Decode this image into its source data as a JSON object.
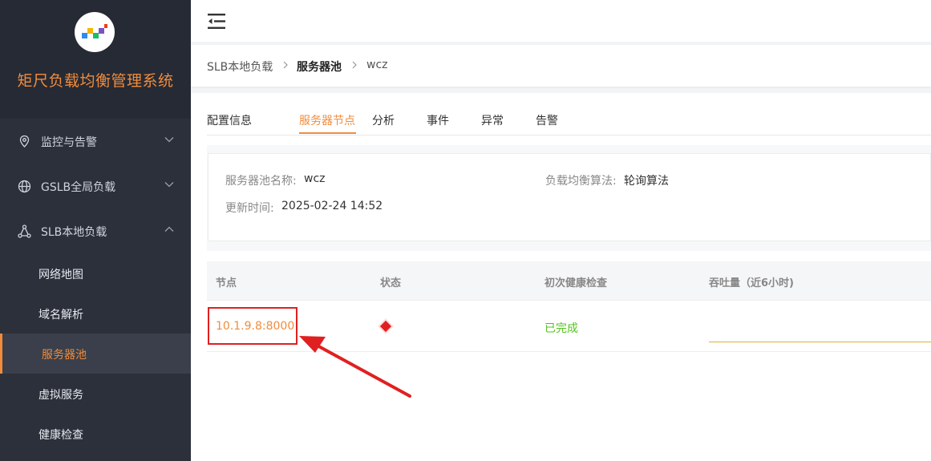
{
  "app": {
    "title": "矩尺负载均衡管理系统"
  },
  "sidebar": {
    "groups": [
      {
        "label": "监控与告警",
        "icon": "location-pin-icon"
      },
      {
        "label": "GSLB全局负载",
        "icon": "globe-icon"
      },
      {
        "label": "SLB本地负载",
        "icon": "network-nodes-icon"
      }
    ],
    "sub_items": [
      "网络地图",
      "域名解析",
      "服务器池",
      "虚拟服务",
      "健康检查"
    ],
    "active_sub_item": "服务器池"
  },
  "breadcrumb": [
    "SLB本地负载",
    "服务器池",
    "wcz"
  ],
  "tabs": [
    "配置信息",
    "服务器节点",
    "分析",
    "事件",
    "异常",
    "告警"
  ],
  "active_tab": "服务器节点",
  "info": {
    "pool_name_label": "服务器池名称:",
    "pool_name_value": "wcz",
    "algo_label": "负载均衡算法:",
    "algo_value": "轮询算法",
    "updated_label": "更新时间:",
    "updated_value": "2025-02-24 14:52"
  },
  "table": {
    "columns": [
      "节点",
      "状态",
      "初次健康检查",
      "吞吐量（近6小时)"
    ],
    "rows": [
      {
        "node": "10.1.9.8:8000",
        "status": "error",
        "health_check": "已完成"
      }
    ]
  },
  "colors": {
    "accent": "#f08c3c",
    "sidebar_bg": "#2b303b",
    "status_error": "#e02020",
    "success": "#52c41a",
    "annotation": "#e02020"
  }
}
